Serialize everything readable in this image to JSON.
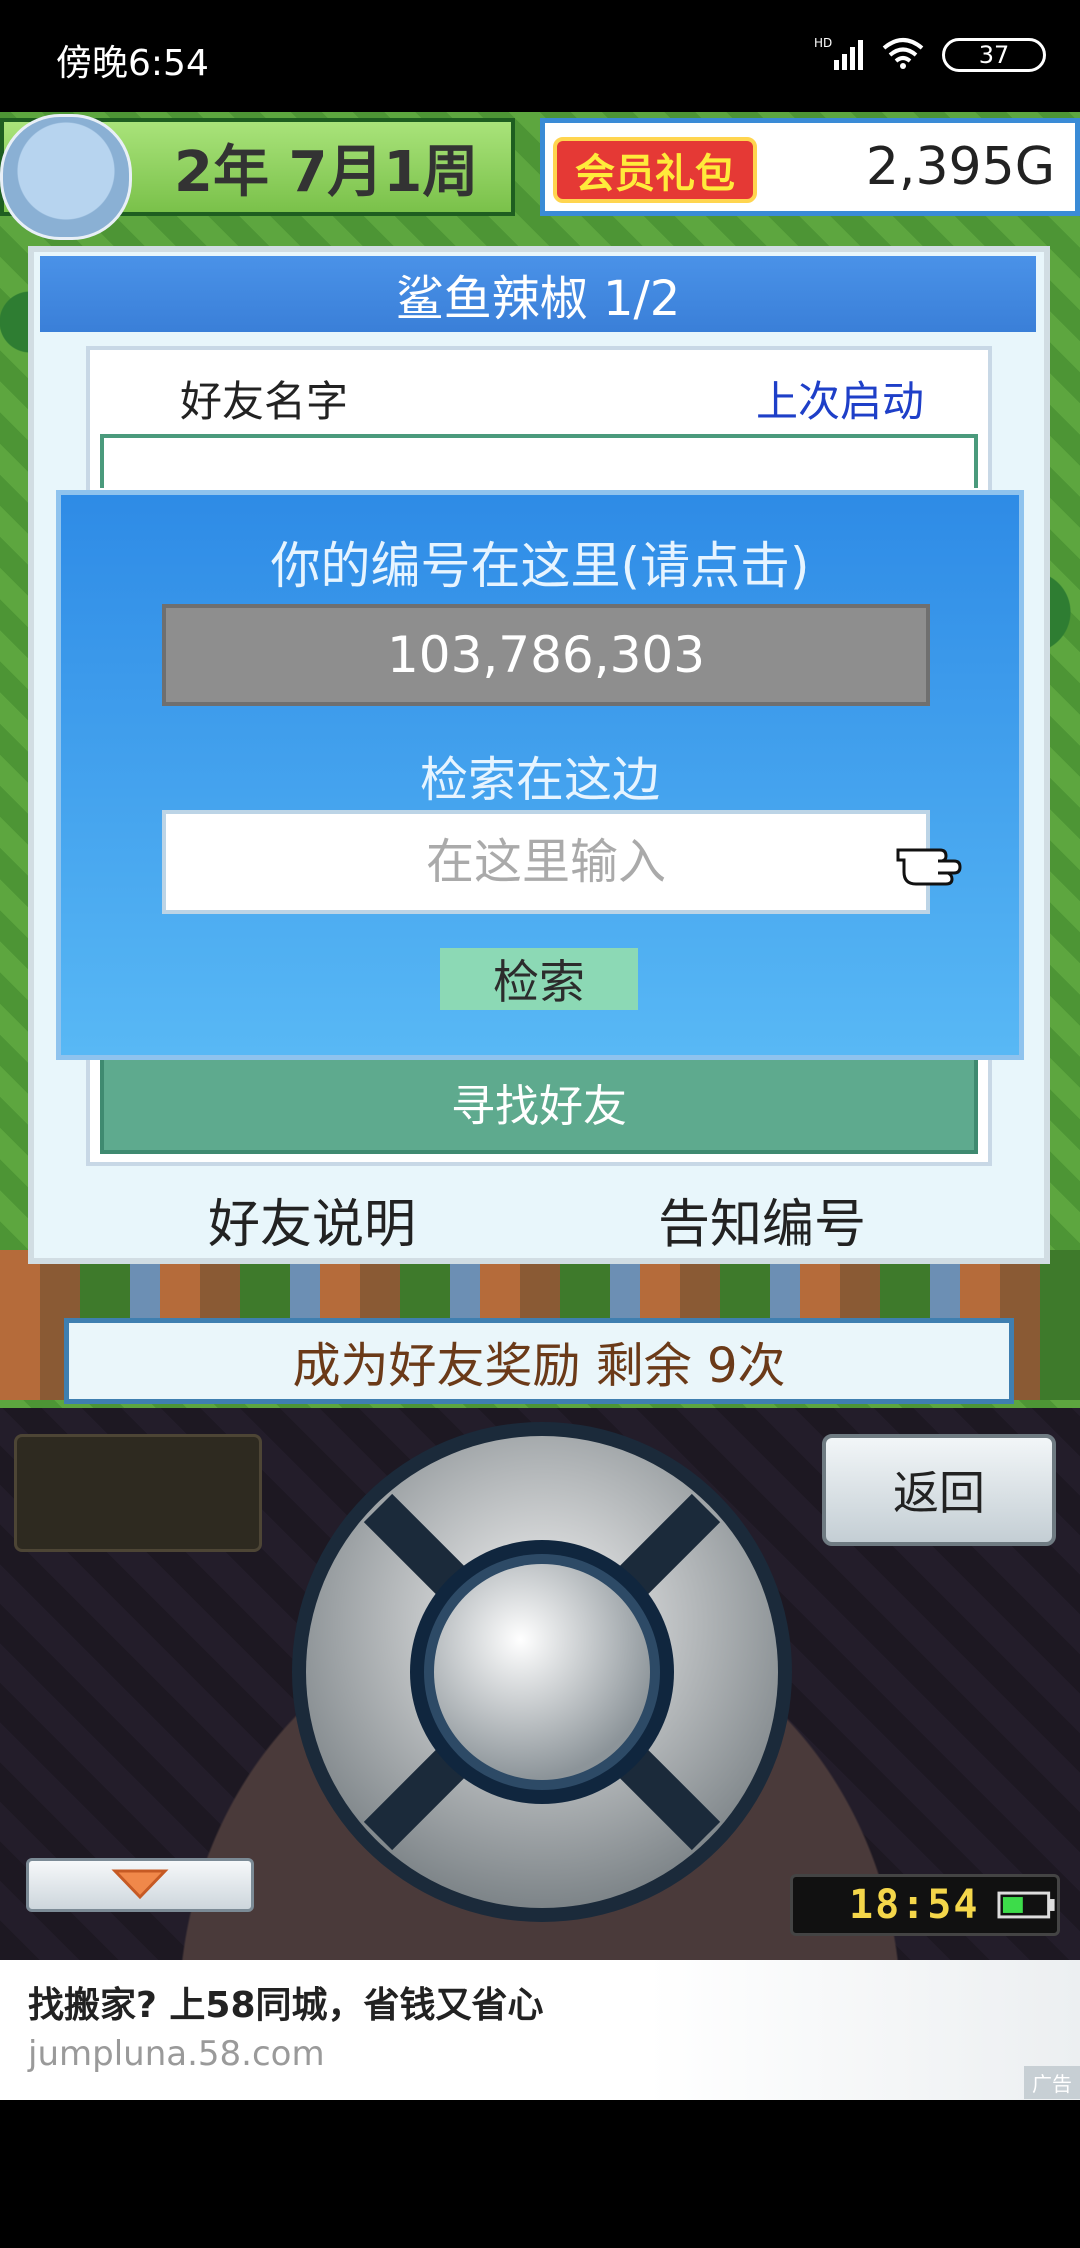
{
  "status_bar": {
    "time": "傍晚6:54",
    "network": "HD",
    "battery": "37"
  },
  "hud": {
    "date": "2年 7月1周",
    "gift_badge": "会员礼包",
    "money": "2,395G"
  },
  "dialog": {
    "title": "鲨鱼辣椒 1/2",
    "col_name": "好友名字",
    "col_last_launch": "上次启动",
    "find_friends": "寻找好友",
    "friend_help": "好友说明",
    "tell_id": "告知编号"
  },
  "popup": {
    "your_id_label": "你的编号在这里(请点击)",
    "your_id": "103,786,303",
    "search_label": "检索在这边",
    "search_placeholder": "在这里输入",
    "search_button": "检索"
  },
  "bonus": {
    "text": "成为好友奖励 剩余 9次"
  },
  "controller": {
    "back": "返回",
    "clock": "18:54"
  },
  "ad": {
    "title": "找搬家? 上58同城，省钱又省心",
    "url": "jumpluna.58.com",
    "tag": "广告"
  },
  "colors": {
    "dialog_title": "#3a7fd8",
    "popup_bg": "#2e8be6",
    "search_button": "#8cd9b5",
    "find_friends": "#5eaa8e",
    "last_launch_text": "#1e3fc8"
  }
}
